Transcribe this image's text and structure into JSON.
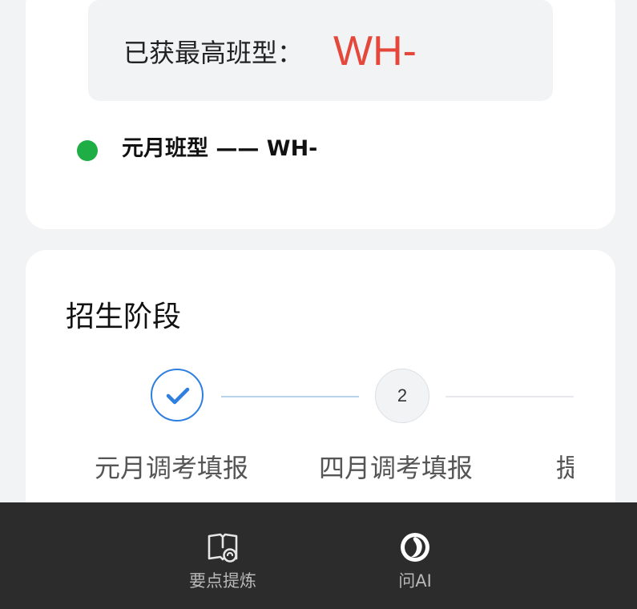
{
  "highest": {
    "label": "已获最高班型：",
    "value": "WH-"
  },
  "status": {
    "text": "元月班型 —— WH-",
    "dot_color": "#1fad45"
  },
  "stage": {
    "title": "招生阶段",
    "steps": [
      {
        "label": "元月调考填报",
        "state": "done"
      },
      {
        "label": "四月调考填报",
        "number": "2",
        "state": "pending"
      },
      {
        "label": "提",
        "state": "pending"
      }
    ]
  },
  "bottom_nav": {
    "items": [
      {
        "label": "要点提炼",
        "icon": "book-icon"
      },
      {
        "label": "问AI",
        "icon": "ai-orb-icon"
      }
    ]
  },
  "colors": {
    "highlight": "#e5483b",
    "accent": "#2f7fe0",
    "bar_background": "#2c2c2c"
  }
}
